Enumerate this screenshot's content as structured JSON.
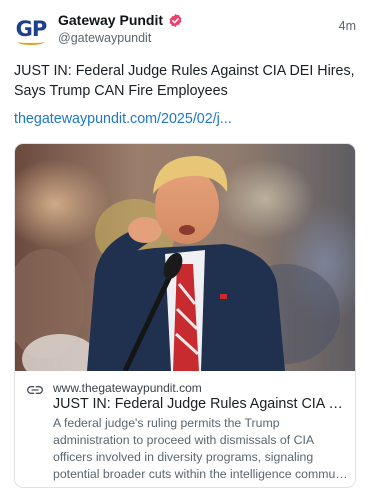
{
  "account": {
    "display_name": "Gateway Pundit",
    "handle": "@gatewaypundit",
    "avatar_text": "GP",
    "verified": true,
    "verified_color": "#ee3f6b"
  },
  "post": {
    "time": "4m",
    "text": "JUST IN: Federal Judge Rules Against CIA DEI Hires, Says Trump CAN Fire Employees",
    "link_text": "thegatewaypundit.com/2025/02/j..."
  },
  "link_card": {
    "image_icon": "photo",
    "link_icon": "link-icon",
    "domain": "www.thegatewaypundit.com",
    "title": "JUST IN: Federal Judge Rules Against CIA DEI ...",
    "description_lines": [
      "A federal judge's ruling permits the Trump",
      "administration to proceed with dismissals of CIA",
      "officers involved in diversity programs, signaling",
      "potential broader cuts within the intelligence commun..."
    ]
  },
  "colors": {
    "link": "#1d78c7",
    "secondary_text": "#5b6670",
    "brand_blue": "#1d3f8f"
  }
}
